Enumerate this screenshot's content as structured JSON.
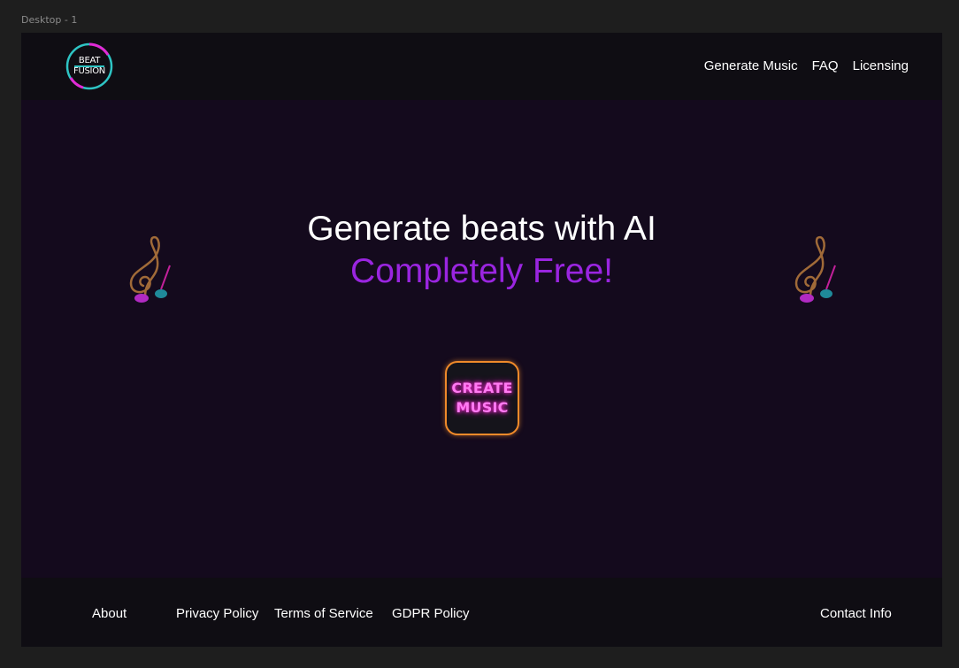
{
  "frame_label": "Desktop - 1",
  "logo": {
    "line1": "BEAT",
    "line2": "FUSION"
  },
  "nav": [
    "Generate Music",
    "FAQ",
    "Licensing"
  ],
  "hero": {
    "title": "Generate beats with AI",
    "subtitle": "Completely Free!"
  },
  "cta": {
    "line1": "CREATE",
    "line2": "MUSIC"
  },
  "footer": {
    "about": "About",
    "privacy": "Privacy Policy",
    "terms": "Terms of Service",
    "gdpr": "GDPR Policy",
    "contact": "Contact Info"
  },
  "colors": {
    "accent_purple": "#9a25e0",
    "cta_border": "#f08a2a",
    "cta_text": "#ff7af2",
    "logo_teal": "#2ec4c4",
    "logo_magenta": "#e22ad6"
  }
}
